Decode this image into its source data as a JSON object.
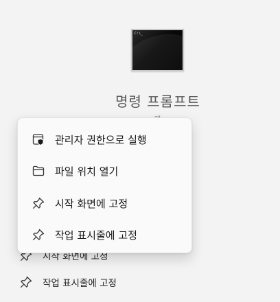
{
  "app": {
    "name": "명령 프롬프트",
    "subtitle": "앱",
    "icon_prompt": "C:\\_"
  },
  "context_menu": {
    "items": [
      {
        "label": "관리자 권한으로 실행",
        "icon": "shield-window-icon"
      },
      {
        "label": "파일 위치 열기",
        "icon": "folder-icon"
      },
      {
        "label": "시작 화면에 고정",
        "icon": "pin-icon"
      },
      {
        "label": "작업 표시줄에 고정",
        "icon": "pin-icon"
      }
    ]
  },
  "background_actions": [
    {
      "label": "시작 화면에 고정",
      "icon": "pin-icon"
    },
    {
      "label": "작업 표시줄에 고정",
      "icon": "pin-icon"
    }
  ],
  "colors": {
    "background": "#f3f3f3",
    "menu_background": "#fafafa"
  }
}
